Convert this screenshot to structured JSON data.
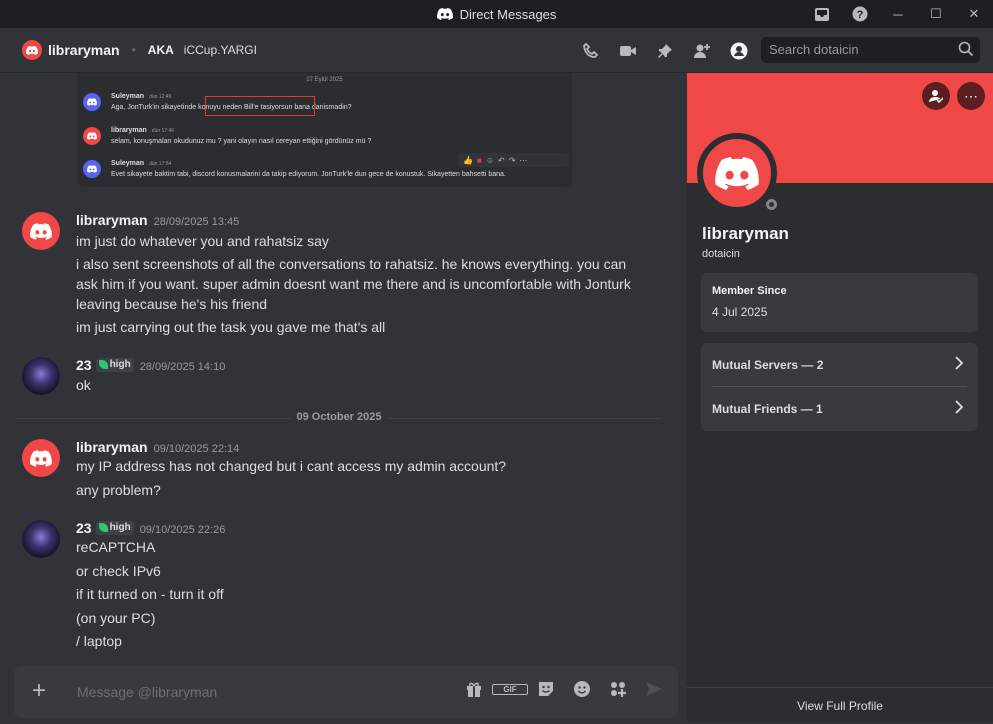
{
  "window": {
    "title": "Direct Messages"
  },
  "header": {
    "username": "libraryman",
    "aka_label": "AKA",
    "aka_name": "iCCup.YARGI"
  },
  "search": {
    "placeholder": "Search dotaicin"
  },
  "embed": {
    "date": "27 Eylül 2025",
    "messages": [
      {
        "name": "Suleyman",
        "time": "dün 12:49",
        "text": "Aga, JonTurk'in sikayetinde konuyu neden Bill'e tasiyorsun bana danismadin?"
      },
      {
        "name": "libraryman",
        "time": "dün 17:46",
        "text": "selam, konuşmaları okudunuz mu ? yani olayın nasıl cereyan ettiğini gördünüz mü ?"
      },
      {
        "name": "Suleyman",
        "time": "dün 17:54",
        "text": "Evet sikayete baktim tabi, discord konusmalarini da takip ediyorum. JonTurk'le dun gece de konustuk. Sikayetten bahsetti bana."
      }
    ]
  },
  "messages": [
    {
      "author": "libraryman",
      "time": "28/09/2025 13:45",
      "lines": [
        "im just do whatever you and rahatsiz say",
        "i also sent screenshots of all the conversations to rahatsiz. he knows everything. you can ask him if you want. super admin doesnt want me there and is uncomfortable with Jonturk leaving because he's his friend",
        "im just carrying out the task you gave me that's all"
      ]
    },
    {
      "author": "23",
      "tag": "high",
      "time": "28/09/2025 14:10",
      "lines": [
        "ok"
      ]
    },
    {
      "author": "libraryman",
      "time": "09/10/2025 22:14",
      "lines": [
        "my IP address has not changed but i cant access my admin account?",
        "any problem?"
      ]
    },
    {
      "author": "23",
      "tag": "high",
      "time": "09/10/2025 22:26",
      "lines": [
        "reCAPTCHA",
        "or check IPv6",
        "if it turned on - turn it off",
        "(on your PC)",
        "/ laptop"
      ]
    }
  ],
  "divider": "09 October 2025",
  "composer": {
    "placeholder": "Message @libraryman",
    "gif_label": "GIF"
  },
  "profile": {
    "display_name": "libraryman",
    "username": "dotaicin",
    "member_since_label": "Member Since",
    "member_since": "4 Jul 2025",
    "mutual_servers": "Mutual Servers — 2",
    "mutual_friends": "Mutual Friends — 1",
    "view_full_profile": "View Full Profile"
  },
  "colors": {
    "brand_red": "#f04747",
    "status_green": "#2dc770"
  }
}
